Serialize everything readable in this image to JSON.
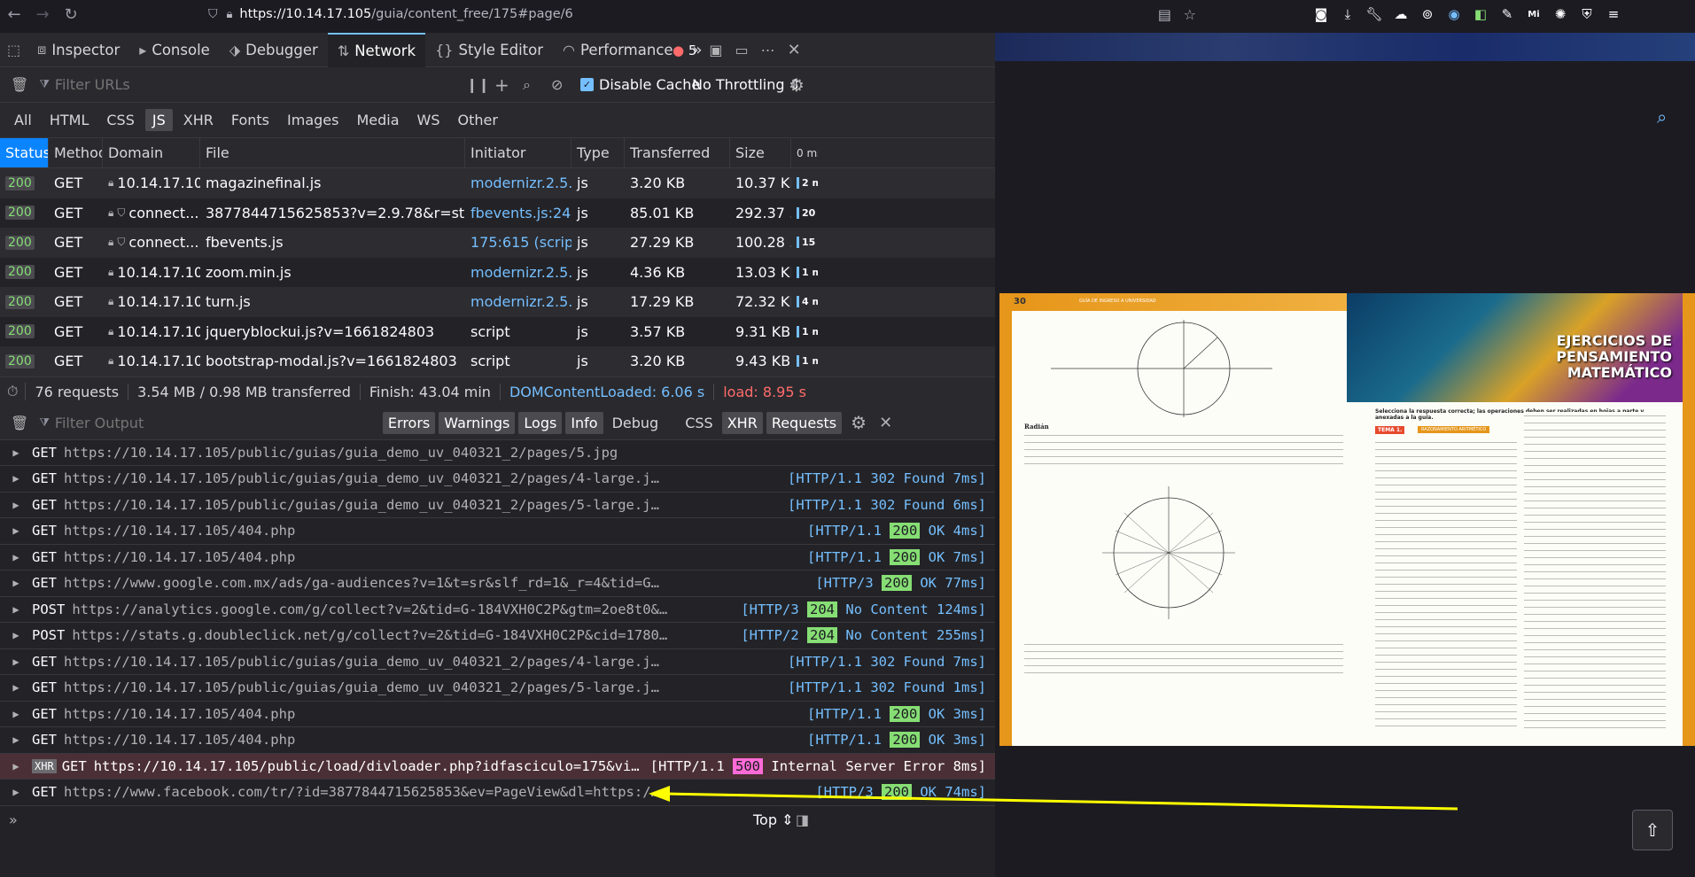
{
  "browser": {
    "url_host": "https://10.14.17.105",
    "url_path": "/guia/content_free/175#page/6",
    "extensions": [
      "pocket-icon",
      "download-icon",
      "wrench-icon",
      "turtle-icon",
      "glasses-icon",
      "extension-icon",
      "toggle-icon",
      "pen-icon",
      "mi-icon",
      "gear-icon",
      "shield-icon",
      "menu-icon"
    ]
  },
  "devtools": {
    "tabs": [
      {
        "label": "Inspector",
        "icon": "inspector-icon"
      },
      {
        "label": "Console",
        "icon": "console-icon"
      },
      {
        "label": "Debugger",
        "icon": "debugger-icon"
      },
      {
        "label": "Network",
        "icon": "network-icon"
      },
      {
        "label": "Style Editor",
        "icon": "style-editor-icon"
      },
      {
        "label": "Performance",
        "icon": "performance-icon"
      }
    ],
    "error_count": "5",
    "network": {
      "filter_placeholder": "Filter URLs",
      "disable_cache_label": "Disable Cache",
      "throttling": "No Throttling",
      "type_filters": [
        "All",
        "HTML",
        "CSS",
        "JS",
        "XHR",
        "Fonts",
        "Images",
        "Media",
        "WS",
        "Other"
      ],
      "active_type": "JS",
      "columns": [
        "Status",
        "Method",
        "Domain",
        "File",
        "Initiator",
        "Type",
        "Transferred",
        "Size",
        "0 ms"
      ],
      "rows": [
        {
          "status": "200",
          "method": "GET",
          "domain": "10.14.17.105",
          "file": "magazinefinal.js",
          "initiator": "modernizr.2.5.3....",
          "type": "js",
          "transferred": "3.20 KB",
          "size": "10.37 KB",
          "wf": "2 m"
        },
        {
          "status": "200",
          "method": "GET",
          "domain": "connect....",
          "file": "3877844715625853?v=2.9.78&r=stable",
          "initiator": "fbevents.js:24 (s...",
          "type": "js",
          "transferred": "85.01 KB",
          "size": "292.37 ...",
          "wf": "20"
        },
        {
          "status": "200",
          "method": "GET",
          "domain": "connect....",
          "file": "fbevents.js",
          "initiator": "175:615 (script)",
          "type": "js",
          "transferred": "27.29 KB",
          "size": "100.28 ...",
          "wf": "15"
        },
        {
          "status": "200",
          "method": "GET",
          "domain": "10.14.17.105",
          "file": "zoom.min.js",
          "initiator": "modernizr.2.5.3....",
          "type": "js",
          "transferred": "4.36 KB",
          "size": "13.03 KB",
          "wf": "1 m"
        },
        {
          "status": "200",
          "method": "GET",
          "domain": "10.14.17.105",
          "file": "turn.js",
          "initiator": "modernizr.2.5.3....",
          "type": "js",
          "transferred": "17.29 KB",
          "size": "72.32 KB",
          "wf": "4 m"
        },
        {
          "status": "200",
          "method": "GET",
          "domain": "10.14.17.105",
          "file": "jqueryblockui.js?v=1661824803",
          "initiator": "script",
          "type": "js",
          "transferred": "3.57 KB",
          "size": "9.31 KB",
          "wf": "1 m"
        },
        {
          "status": "200",
          "method": "GET",
          "domain": "10.14.17.105",
          "file": "bootstrap-modal.js?v=1661824803",
          "initiator": "script",
          "type": "js",
          "transferred": "3.20 KB",
          "size": "9.43 KB",
          "wf": "1 m"
        }
      ],
      "summary": {
        "requests": "76 requests",
        "transferred": "3.54 MB / 0.98 MB transferred",
        "finish": "Finish: 43.04 min",
        "domcontent": "DOMContentLoaded: 6.06 s",
        "load": "load: 8.95 s"
      }
    },
    "console": {
      "filter_placeholder": "Filter Output",
      "filters": [
        "Errors",
        "Warnings",
        "Logs",
        "Info",
        "Debug",
        "CSS",
        "XHR",
        "Requests"
      ],
      "active_filters": [
        "Errors",
        "Warnings",
        "Logs",
        "Info",
        "XHR",
        "Requests"
      ],
      "logs": [
        {
          "method": "GET",
          "url": "https://10.14.17.105/public/guias/guia_demo_uv_040321_2/pages/5.jpg",
          "proto": "",
          "code": "",
          "msg": ""
        },
        {
          "method": "GET",
          "url": "https://10.14.17.105/public/guias/guia_demo_uv_040321_2/pages/4-large.jpg",
          "proto": "[HTTP/1.1",
          "code": "302",
          "msg": "Found 7ms]"
        },
        {
          "method": "GET",
          "url": "https://10.14.17.105/public/guias/guia_demo_uv_040321_2/pages/5-large.jpg",
          "proto": "[HTTP/1.1",
          "code": "302",
          "msg": "Found 6ms]"
        },
        {
          "method": "GET",
          "url": "https://10.14.17.105/404.php",
          "proto": "[HTTP/1.1",
          "code": "200",
          "msg": "OK 4ms]"
        },
        {
          "method": "GET",
          "url": "https://10.14.17.105/404.php",
          "proto": "[HTTP/1.1",
          "code": "200",
          "msg": "OK 7ms]"
        },
        {
          "method": "GET",
          "url": "https://www.google.com.mx/ads/ga-audiences?v=1&t=sr&slf_rd=1&_r=4&tid=G-184VXH0C2P&cid=17…",
          "proto": "[HTTP/3",
          "code": "200",
          "msg": "OK 77ms]"
        },
        {
          "method": "POST",
          "url": "https://analytics.google.com/g/collect?v=2&tid=G-184VXH0C2P&gtm=2oe8t0&_p=90056…",
          "proto": "[HTTP/3",
          "code": "204",
          "msg": "No Content 124ms]"
        },
        {
          "method": "POST",
          "url": "https://stats.g.doubleclick.net/g/collect?v=2&tid=G-184VXH0C2P&cid=1780418789.1…",
          "proto": "[HTTP/2",
          "code": "204",
          "msg": "No Content 255ms]"
        },
        {
          "method": "GET",
          "url": "https://10.14.17.105/public/guias/guia_demo_uv_040321_2/pages/4-large.jpg",
          "proto": "[HTTP/1.1",
          "code": "302",
          "msg": "Found 7ms]"
        },
        {
          "method": "GET",
          "url": "https://10.14.17.105/public/guias/guia_demo_uv_040321_2/pages/5-large.jpg",
          "proto": "[HTTP/1.1",
          "code": "302",
          "msg": "Found 1ms]"
        },
        {
          "method": "GET",
          "url": "https://10.14.17.105/404.php",
          "proto": "[HTTP/1.1",
          "code": "200",
          "msg": "OK 3ms]"
        },
        {
          "method": "GET",
          "url": "https://10.14.17.105/404.php",
          "proto": "[HTTP/1.1",
          "code": "200",
          "msg": "OK 3ms]"
        },
        {
          "method": "GET",
          "url": "https://10.14.17.105/public/load/divloader.php?idfasciculo=175&vi…",
          "proto": "[HTTP/1.1",
          "code": "500",
          "msg": "Internal Server Error 8ms]",
          "xhr": "XHR",
          "error": true
        },
        {
          "method": "GET",
          "url": "https://www.facebook.com/tr/?id=3877844715625853&ev=PageView&dl=https://10.14.17.105/guia…",
          "proto": "[HTTP/3",
          "code": "200",
          "msg": "OK 74ms]"
        }
      ],
      "scroll_position": "Top"
    }
  },
  "book": {
    "left_page_number": "30",
    "left_header": "GUÍA DE INGRESO A UNIVERSIDAD",
    "left_heading": "Radián",
    "right_title": "EJERCICIOS DE PENSAMIENTO MATEMÁTICO",
    "right_instruction": "Selecciona la respuesta correcta; las operaciones deben ser realizadas en hojas a parte y anexadas a la guía.",
    "right_tema": "TEMA 1.",
    "right_subtema": "RAZONAMIENTO ARITMÉTICO"
  },
  "colors": {
    "accent": "#75bfff",
    "error_bg": "#4b2f36",
    "book_orange": "#e6961a",
    "arrow": "#ffff00"
  }
}
